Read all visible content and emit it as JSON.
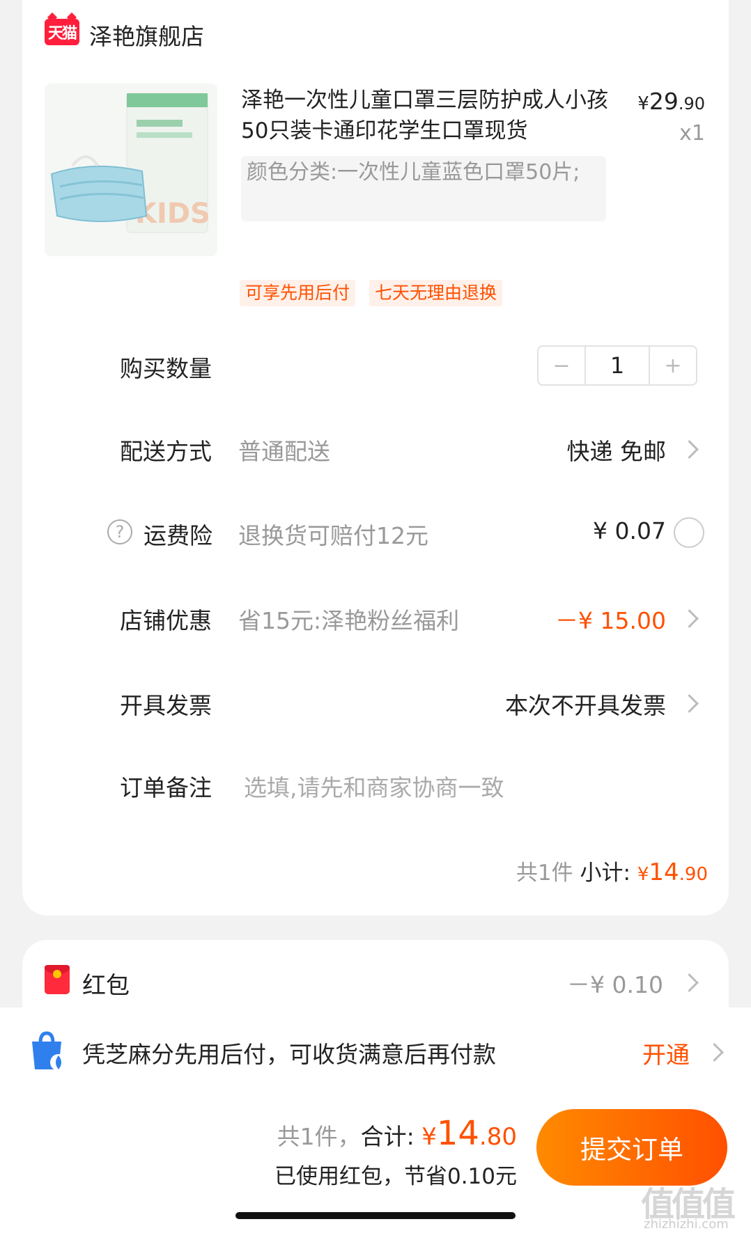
{
  "store": {
    "logo_text": "天猫",
    "name": "泽艳旗舰店"
  },
  "product": {
    "title": "泽艳一次性儿童口罩三层防护成人小孩50只装卡通印花学生口罩现货",
    "spec": "颜色分类:一次性儿童蓝色口罩50片;",
    "price_currency": "¥",
    "price_int": "29",
    "price_dec": ".90",
    "quantity_mark": "x1",
    "tags": [
      "可享先用后付",
      "七天无理由退换"
    ]
  },
  "rows": {
    "quantity": {
      "label": "购买数量",
      "value": "1",
      "minus": "−",
      "plus": "+"
    },
    "delivery": {
      "label": "配送方式",
      "sub": "普通配送",
      "value": "快递 免邮"
    },
    "insurance": {
      "label": "运费险",
      "sub": "退换货可赔付12元",
      "value": "¥ 0.07",
      "help": "?"
    },
    "discount": {
      "label": "店铺优惠",
      "sub": "省15元:泽艳粉丝福利",
      "value": "－¥ 15.00"
    },
    "invoice": {
      "label": "开具发票",
      "value": "本次不开具发票"
    },
    "note": {
      "label": "订单备注",
      "placeholder": "选填,请先和商家协商一致"
    }
  },
  "subtotal": {
    "count": "共1件",
    "label": "小计:",
    "currency": "¥",
    "int": "14",
    "dec": ".90"
  },
  "red_packet": {
    "label": "红包",
    "value": "－¥ 0.10"
  },
  "pay_later": {
    "text": "凭芝麻分先用后付，可收货满意后再付款",
    "action": "开通"
  },
  "total": {
    "count": "共1件，",
    "label": "合计:",
    "currency": "¥",
    "int": "14",
    "dec": ".80",
    "saved": "已使用红包，节省0.10元"
  },
  "submit_label": "提交订单",
  "watermark": {
    "text": "值值值",
    "url": "zhizhizhi.com"
  },
  "colors": {
    "accent": "#ff5000",
    "tmall_red": "#ff1f3c",
    "muted": "#999999"
  }
}
